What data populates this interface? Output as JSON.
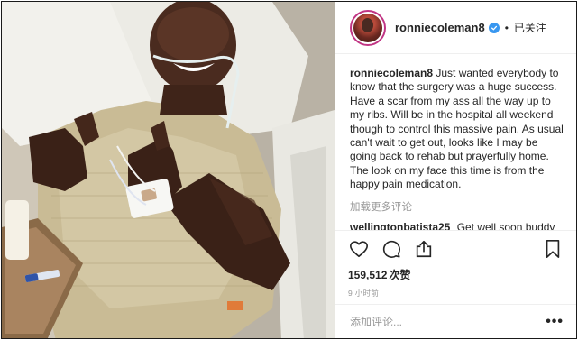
{
  "post": {
    "username": "ronniecoleman8",
    "dot": "•",
    "follow_status": "已关注",
    "photo_alt": "Man in hospital bed giving thumbs up",
    "caption_username": "ronniecoleman8",
    "caption_text": "Just wanted everybody to know that the surgery was a huge success. Have a scar from my ass all the way up to my ribs. Will be in the hospital all weekend though to control this massive pain. As usual can't wait to get out, looks like I may be going back to rehab but prayerfully home. The look on my face this time is from the happy pain medication.",
    "load_more": "加载更多评论",
    "comments": [
      {
        "username": "wellingtonbatista25",
        "text": "Get well soon buddy"
      }
    ],
    "likes_count": "159,512",
    "likes_label": "次赞",
    "time": "9 小时前",
    "add_comment_placeholder": "添加评论...",
    "more_menu": "•••"
  },
  "icons": {
    "verified": "verified-badge-icon",
    "like": "heart-icon",
    "comment": "comment-icon",
    "share": "share-icon",
    "save": "bookmark-icon"
  },
  "colors": {
    "accent": "#3897f0",
    "avatar_ring": "#c13584",
    "muted": "#999999",
    "text": "#262626",
    "border": "#efefef"
  }
}
